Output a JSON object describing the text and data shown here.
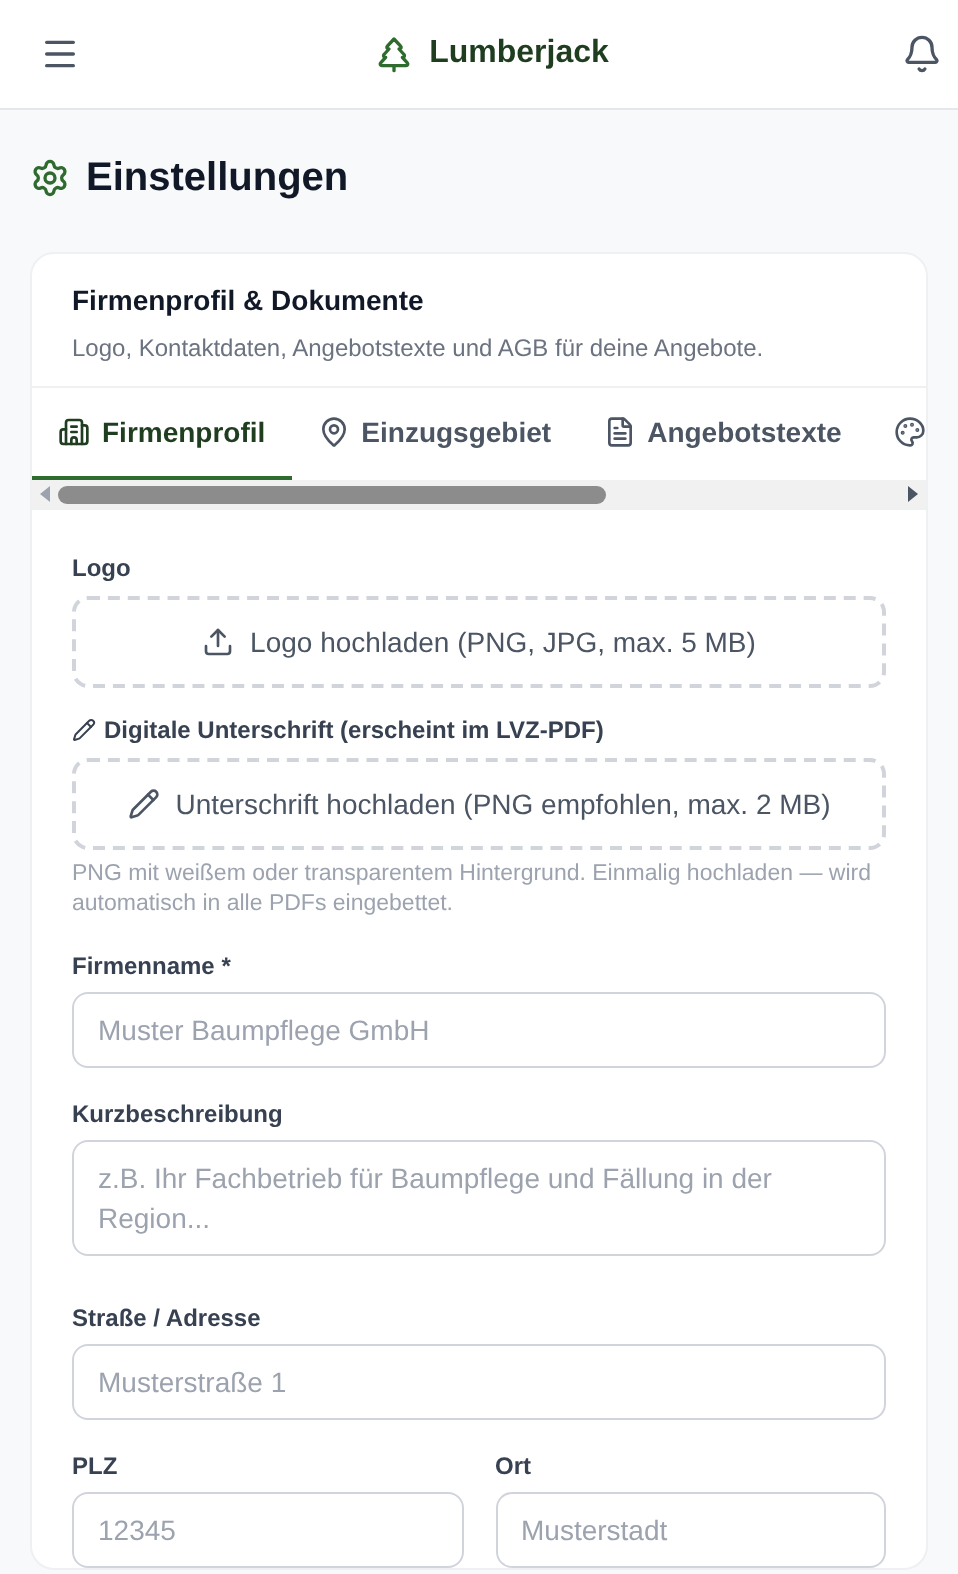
{
  "header": {
    "brand": "Lumberjack"
  },
  "page_title": "Einstellungen",
  "card": {
    "title": "Firmenprofil & Dokumente",
    "subtitle": "Logo, Kontaktdaten, Angebotstexte und AGB für deine Angebote."
  },
  "tabs": [
    {
      "label": "Firmenprofil",
      "selected": true
    },
    {
      "label": "Einzugsgebiet",
      "selected": false
    },
    {
      "label": "Angebotstexte",
      "selected": false
    },
    {
      "selected": false
    }
  ],
  "uploads": [
    {
      "kind": "logo",
      "label": "Logo",
      "text": "Logo hochladen (PNG, JPG, max. 5 MB)"
    },
    {
      "kind": "signature",
      "label": "Digitale Unterschrift (erscheint im LVZ-PDF)",
      "text": "Unterschrift hochladen (PNG empfohlen, max. 2 MB)",
      "hint": "PNG mit weißem oder transparentem Hintergrund. Einmalig hochladen — wird automatisch in alle PDFs eingebettet."
    }
  ],
  "field_rows": [
    [
      {
        "kind": "text",
        "label": "Firmenname *",
        "placeholder": "Muster Baumpflege GmbH"
      }
    ],
    [
      {
        "kind": "textarea",
        "label": "Kurzbeschreibung",
        "placeholder": "z.B. Ihr Fachbetrieb für Baumpflege und Fällung in der Region..."
      }
    ],
    [
      {
        "kind": "text",
        "label": "Straße / Adresse",
        "placeholder": "Musterstraße 1"
      }
    ],
    [
      {
        "kind": "text",
        "label": "PLZ",
        "placeholder": "12345"
      },
      {
        "kind": "text",
        "label": "Ort",
        "placeholder": "Musterstadt"
      }
    ]
  ]
}
